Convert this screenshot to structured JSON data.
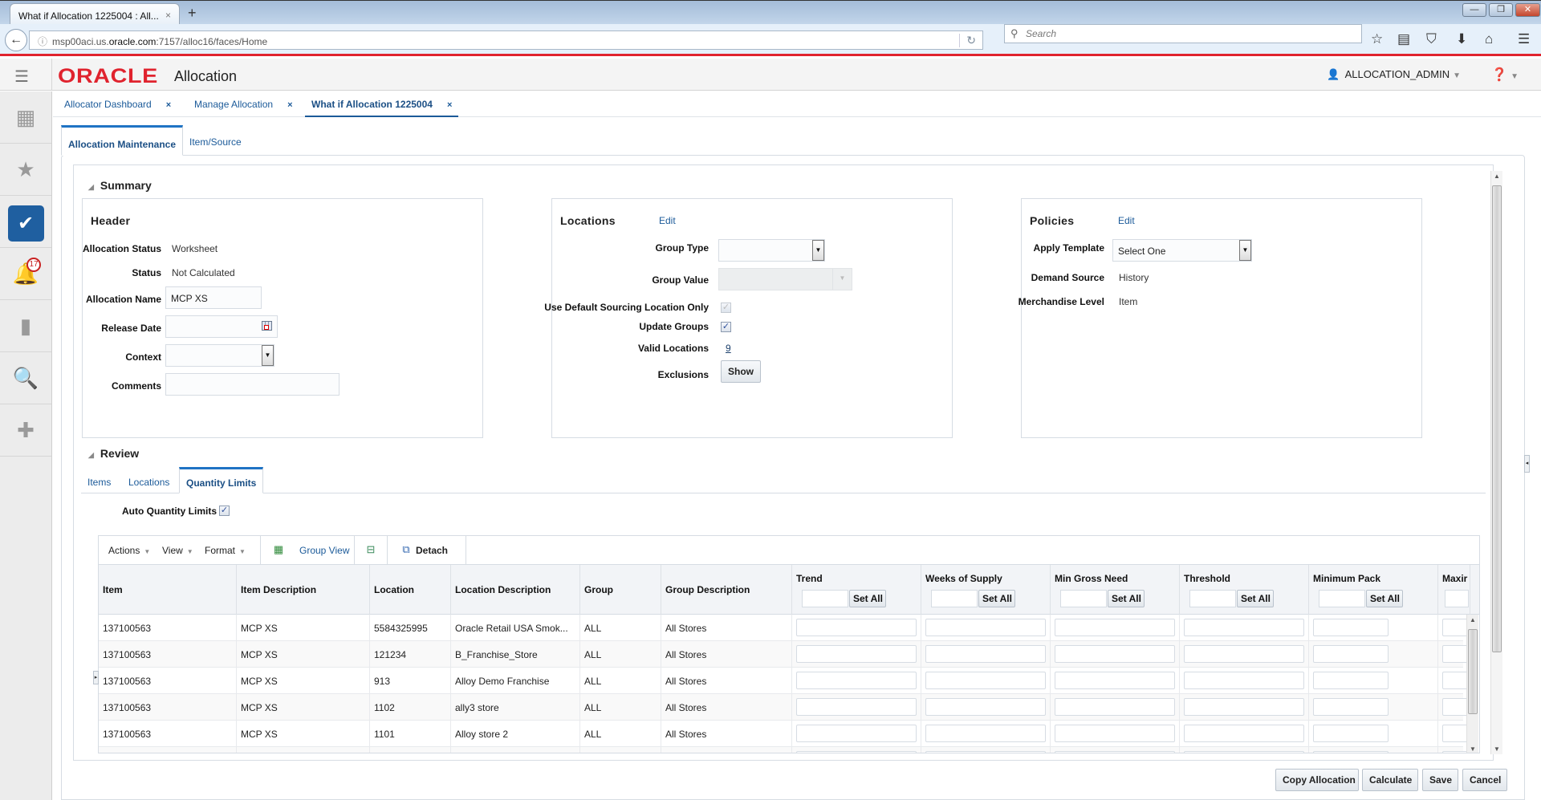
{
  "browser": {
    "tab_title": "What if Allocation 1225004 : All...",
    "url_prefix": "msp00aci.us.",
    "url_host": "oracle.com",
    "url_suffix": ":7157/alloc16/faces/Home",
    "search_placeholder": "Search",
    "new_tab": "+",
    "close_tab": "×"
  },
  "app": {
    "logo": "ORACLE",
    "name": "Allocation",
    "user": "ALLOCATION_ADMIN",
    "notification_count": "17"
  },
  "sidebar": {
    "items": [
      {
        "icon": "grid-icon"
      },
      {
        "icon": "star-icon"
      },
      {
        "icon": "clipboard-check-icon",
        "active": true
      },
      {
        "icon": "bell-icon"
      },
      {
        "icon": "bar-chart-icon"
      },
      {
        "icon": "search-icon"
      },
      {
        "icon": "plus-icon"
      }
    ]
  },
  "page_tabs": [
    {
      "label": "Allocator Dashboard",
      "close": "×"
    },
    {
      "label": "Manage Allocation",
      "close": "×"
    },
    {
      "label": "What if Allocation 1225004",
      "close": "×",
      "active": true
    }
  ],
  "sub_tabs": [
    {
      "label": "Allocation Maintenance",
      "active": true
    },
    {
      "label": "Item/Source"
    }
  ],
  "summary": {
    "title": "Summary",
    "header": {
      "title": "Header",
      "allocation_status_label": "Allocation Status",
      "allocation_status": "Worksheet",
      "status_label": "Status",
      "status": "Not Calculated",
      "allocation_name_label": "Allocation Name",
      "allocation_name": "MCP XS",
      "release_date_label": "Release Date",
      "release_date": "",
      "context_label": "Context",
      "context": "",
      "comments_label": "Comments",
      "comments": ""
    },
    "locations": {
      "title": "Locations",
      "edit": "Edit",
      "group_type_label": "Group Type",
      "group_type": "",
      "group_value_label": "Group Value",
      "group_value": "",
      "use_default_label": "Use Default Sourcing Location Only",
      "use_default_checked": true,
      "update_groups_label": "Update Groups",
      "update_groups_checked": true,
      "valid_locations_label": "Valid Locations",
      "valid_locations": "9",
      "exclusions_label": "Exclusions",
      "show_button": "Show"
    },
    "policies": {
      "title": "Policies",
      "edit": "Edit",
      "apply_template_label": "Apply Template",
      "apply_template": "Select One",
      "demand_source_label": "Demand Source",
      "demand_source": "History",
      "merchandise_level_label": "Merchandise Level",
      "merchandise_level": "Item"
    }
  },
  "review": {
    "title": "Review",
    "tabs": [
      {
        "label": "Items"
      },
      {
        "label": "Locations"
      },
      {
        "label": "Quantity Limits",
        "active": true
      }
    ],
    "auto_quantity_limits_label": "Auto Quantity Limits",
    "auto_quantity_limits_checked": true,
    "toolbar": {
      "actions": "Actions",
      "view": "View",
      "format": "Format",
      "group_view": "Group View",
      "detach": "Detach"
    },
    "set_all": "Set All",
    "columns": [
      "Item",
      "Item Description",
      "Location",
      "Location Description",
      "Group",
      "Group Description",
      "Trend",
      "Weeks of Supply",
      "Min Gross Need",
      "Threshold",
      "Minimum Pack",
      "Maxir"
    ],
    "rows": [
      {
        "item": "137100563",
        "item_desc": "MCP XS",
        "location": "5584325995",
        "location_desc": "Oracle Retail USA Smok...",
        "group": "ALL",
        "group_desc": "All Stores"
      },
      {
        "item": "137100563",
        "item_desc": "MCP XS",
        "location": "121234",
        "location_desc": "B_Franchise_Store",
        "group": "ALL",
        "group_desc": "All Stores"
      },
      {
        "item": "137100563",
        "item_desc": "MCP XS",
        "location": "913",
        "location_desc": "Alloy Demo Franchise",
        "group": "ALL",
        "group_desc": "All Stores"
      },
      {
        "item": "137100563",
        "item_desc": "MCP XS",
        "location": "1102",
        "location_desc": "ally3 store",
        "group": "ALL",
        "group_desc": "All Stores"
      },
      {
        "item": "137100563",
        "item_desc": "MCP XS",
        "location": "1101",
        "location_desc": "Alloy store 2",
        "group": "ALL",
        "group_desc": "All Stores"
      }
    ]
  },
  "actions": {
    "copy": "Copy Allocation",
    "calculate": "Calculate",
    "save": "Save",
    "cancel": "Cancel"
  }
}
